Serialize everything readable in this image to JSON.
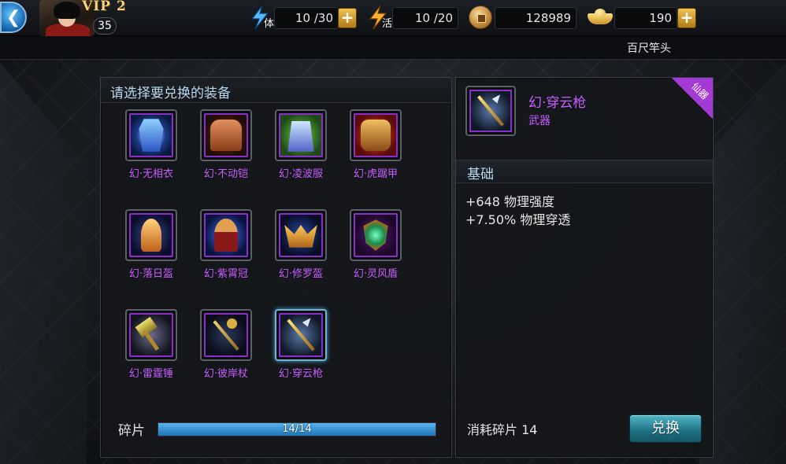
{
  "header": {
    "vip": "VIP 2",
    "level": "35",
    "stamina": {
      "icon_tag": "体",
      "value": "10 /30"
    },
    "vitality": {
      "icon_tag": "活",
      "value": "10 /20"
    },
    "coins": "128989",
    "ingots": "190",
    "subtitle": "百尺竿头"
  },
  "left": {
    "title": "请选择要兑换的装备",
    "items": [
      {
        "name": "幻·无相衣",
        "icon": "armor-robe-icon"
      },
      {
        "name": "幻·不动铠",
        "icon": "armor-plate-icon"
      },
      {
        "name": "幻·凌波服",
        "icon": "armor-wave-icon"
      },
      {
        "name": "幻·虎踞甲",
        "icon": "armor-tiger-icon"
      },
      {
        "name": "幻·落日盔",
        "icon": "helmet-sunset-icon"
      },
      {
        "name": "幻·紫霄冠",
        "icon": "helmet-crown-icon"
      },
      {
        "name": "幻·修罗盔",
        "icon": "helmet-asura-icon"
      },
      {
        "name": "幻·灵风盾",
        "icon": "shield-wind-icon"
      },
      {
        "name": "幻·雷霆锤",
        "icon": "hammer-thunder-icon"
      },
      {
        "name": "幻·彼岸杖",
        "icon": "staff-shore-icon"
      },
      {
        "name": "幻·穿云枪",
        "icon": "spear-cloud-icon"
      }
    ],
    "fragment_label": "碎片",
    "progress": {
      "current": 14,
      "max": 14,
      "text": "14/14"
    }
  },
  "right": {
    "selected_name": "幻·穿云枪",
    "selected_type": "武器",
    "badge": "仙器",
    "section": "基础",
    "stats": [
      "+648 物理强度",
      "+7.50% 物理穿透"
    ],
    "cost": "消耗碎片 14",
    "button": "兑换"
  }
}
